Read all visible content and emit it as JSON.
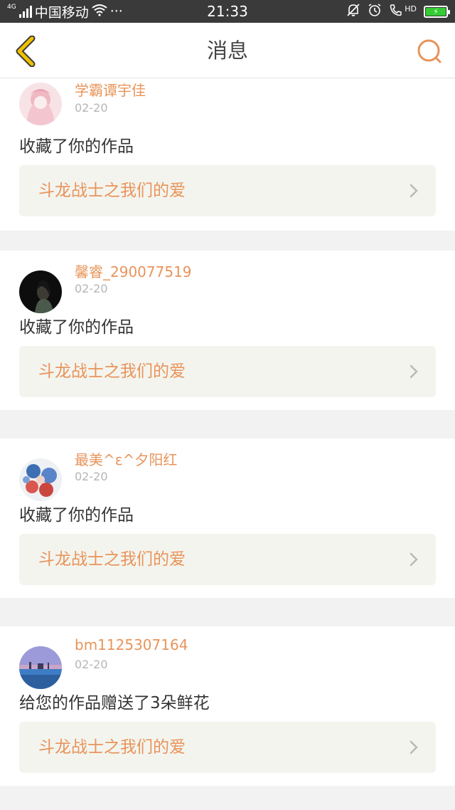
{
  "status_bar": {
    "network": "4G",
    "carrier": "中国移动",
    "wifi_icon": "wifi-icon",
    "dots": "···",
    "time": "21:33",
    "hd": "HD"
  },
  "header": {
    "title": "消息",
    "back_icon": "chevron-left-icon",
    "search_icon": "search-icon"
  },
  "colors": {
    "accent_orange": "#e8945a",
    "back_yellow": "#f0c000",
    "battery_green": "#33cc33",
    "status_bar_bg": "#3a3a3a",
    "link_bg": "#f4f4ee"
  },
  "messages": [
    {
      "username": "学霸谭宇佳",
      "date": "02-20",
      "action": "收藏了你的作品",
      "work_title": "斗龙战士之我们的爱"
    },
    {
      "username": "馨睿_290077519",
      "date": "02-20",
      "action": "收藏了你的作品",
      "work_title": "斗龙战士之我们的爱"
    },
    {
      "username": "最美^ε^夕阳红",
      "date": "02-20",
      "action": "收藏了你的作品",
      "work_title": "斗龙战士之我们的爱"
    },
    {
      "username": "bm1125307164",
      "date": "02-20",
      "action": "给您的作品赠送了3朵鲜花",
      "work_title": "斗龙战士之我们的爱"
    }
  ]
}
